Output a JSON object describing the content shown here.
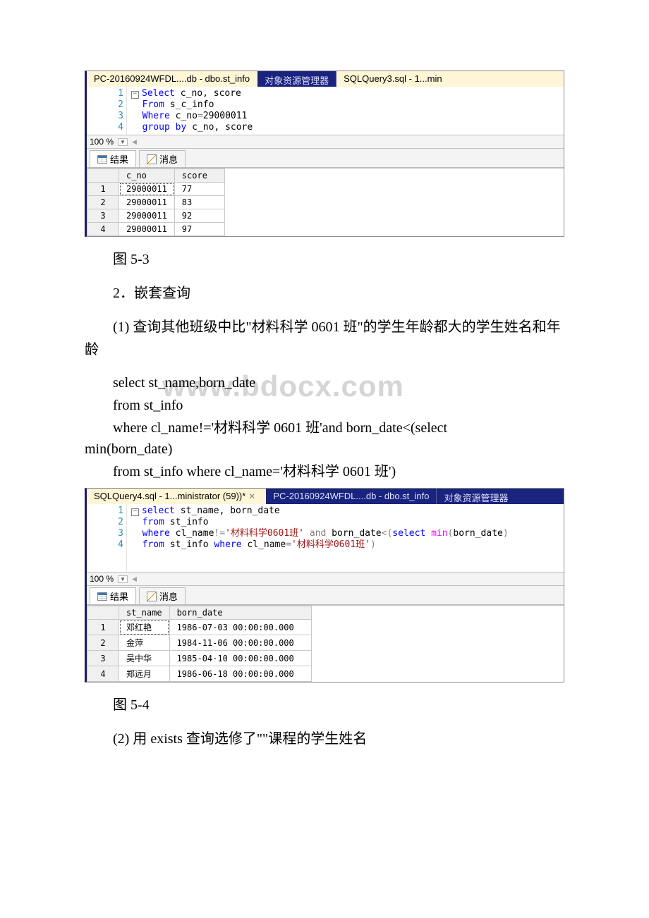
{
  "watermark": "www.bdocx.com",
  "fig1": {
    "tabs": {
      "active": "PC-20160924WFDL....db - dbo.st_info",
      "middle": "对象资源管理器",
      "right": "SQLQuery3.sql - 1...min"
    },
    "zoom": "100 %",
    "results_tab": "结果",
    "messages_tab": "消息",
    "sql": {
      "l1a": "Select",
      "l1b": " c_no, score",
      "l2a": "From",
      "l2b": " s_c_info",
      "l3a": "Where",
      "l3b": " c_no",
      "l3c": "=",
      "l3d": "29000011",
      "l4a": "group",
      "l4b": " by",
      "l4c": " c_no, score"
    },
    "cols": {
      "c1": "c_no",
      "c2": "score"
    },
    "rows": [
      {
        "n": "1",
        "c_no": "29000011",
        "score": "77"
      },
      {
        "n": "2",
        "c_no": "29000011",
        "score": "83"
      },
      {
        "n": "3",
        "c_no": "29000011",
        "score": "92"
      },
      {
        "n": "4",
        "c_no": "29000011",
        "score": "97"
      }
    ],
    "caption": "图 5-3"
  },
  "section2_title": "2．嵌套查询",
  "q1_text": "(1) 查询其他班级中比\"材料科学 0601 班\"的学生年龄都大的学生姓名和年龄",
  "q1_sql": {
    "l1": "select st_name,born_date",
    "l2": "from st_info",
    "l3_first": "where cl_name!='材料科学 0601 班'and born_date<(select",
    "l3_cont": "min(born_date)",
    "l4": "from st_info where cl_name='材料科学 0601 班')"
  },
  "fig2": {
    "tabs": {
      "active": "SQLQuery4.sql - 1...ministrator (59))*",
      "middle": "PC-20160924WFDL....db - dbo.st_info",
      "right": "对象资源管理器"
    },
    "close_x": "✕",
    "zoom": "100 %",
    "results_tab": "结果",
    "messages_tab": "消息",
    "sql": {
      "l1a": "select",
      "l1b": " st_name, born_date",
      "l2a": "from",
      "l2b": " st_info",
      "l3a": "where",
      "l3b": " cl_name",
      "l3c": "!=",
      "l3d": "'材料科学0601班'",
      "l3e": "and",
      "l3f": " born_date",
      "l3g": "<(",
      "l3h": "select",
      "l3i": " ",
      "l3j": "min",
      "l3k": "(",
      "l3l": "born_date",
      "l3m": ")",
      "l4a": "from",
      "l4b": " st_info ",
      "l4c": "where",
      "l4d": " cl_name",
      "l4e": "=",
      "l4f": "'材料科学0601班'",
      "l4g": ")"
    },
    "cols": {
      "c1": "st_name",
      "c2": "born_date"
    },
    "rows": [
      {
        "n": "1",
        "st_name": "邓红艳",
        "born_date": "1986-07-03 00:00:00.000"
      },
      {
        "n": "2",
        "st_name": "金萍",
        "born_date": "1984-11-06 00:00:00.000"
      },
      {
        "n": "3",
        "st_name": "吴中华",
        "born_date": "1985-04-10 00:00:00.000"
      },
      {
        "n": "4",
        "st_name": "郑远月",
        "born_date": "1986-06-18 00:00:00.000"
      }
    ],
    "caption": "图 5-4"
  },
  "q2_text": "(2) 用 exists 查询选修了\"\"课程的学生姓名"
}
